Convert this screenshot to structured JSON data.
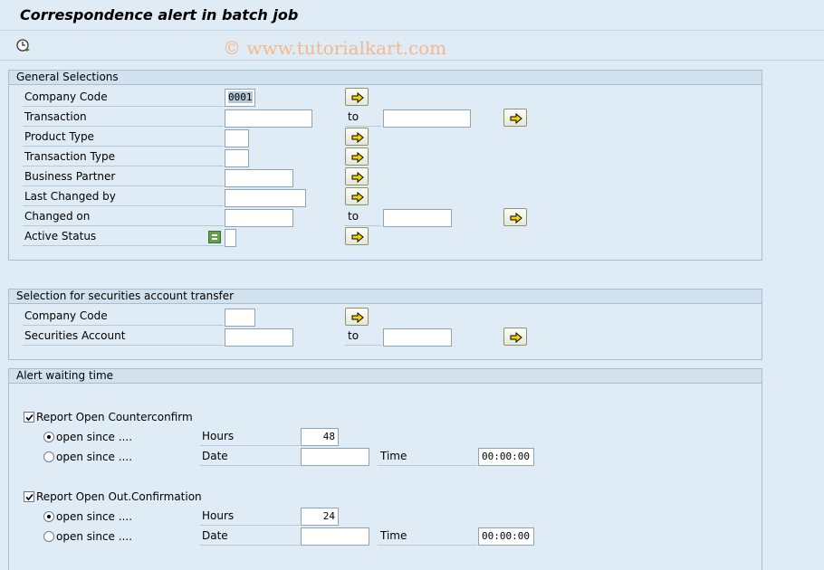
{
  "title": "Correspondence alert in batch job",
  "watermark": "© www.tutorialkart.com",
  "toolbar": {
    "execute_icon": "clock-execute-icon"
  },
  "general": {
    "heading": "General Selections",
    "company_code_label": "Company Code",
    "company_code_value": "0001",
    "transaction_label": "Transaction",
    "product_type_label": "Product Type",
    "transaction_type_label": "Transaction Type",
    "business_partner_label": "Business Partner",
    "last_changed_by_label": "Last Changed by",
    "changed_on_label": "Changed on",
    "active_status_label": "Active Status",
    "to_label": "to"
  },
  "securities": {
    "heading": "Selection for securities account transfer",
    "company_code_label": "Company Code",
    "securities_account_label": "Securities Account",
    "to_label": "to"
  },
  "alert": {
    "heading": "Alert waiting time",
    "counterconfirm": {
      "label": "Report Open Counterconfirm",
      "checked": true,
      "open_since_label": "open since ....",
      "hours_label": "Hours",
      "hours_value": "48",
      "date_label": "Date",
      "time_label": "Time",
      "time_value": "00:00:00"
    },
    "outconfirmation": {
      "label": "Report Open Out.Confirmation",
      "checked": true,
      "open_since_label": "open since ....",
      "hours_label": "Hours",
      "hours_value": "24",
      "date_label": "Date",
      "time_label": "Time",
      "time_value": "00:00:00"
    }
  },
  "colors": {
    "background": "#dfebf5",
    "arrow_button": "#f5d400",
    "active_status_icon": "#64a24a"
  }
}
